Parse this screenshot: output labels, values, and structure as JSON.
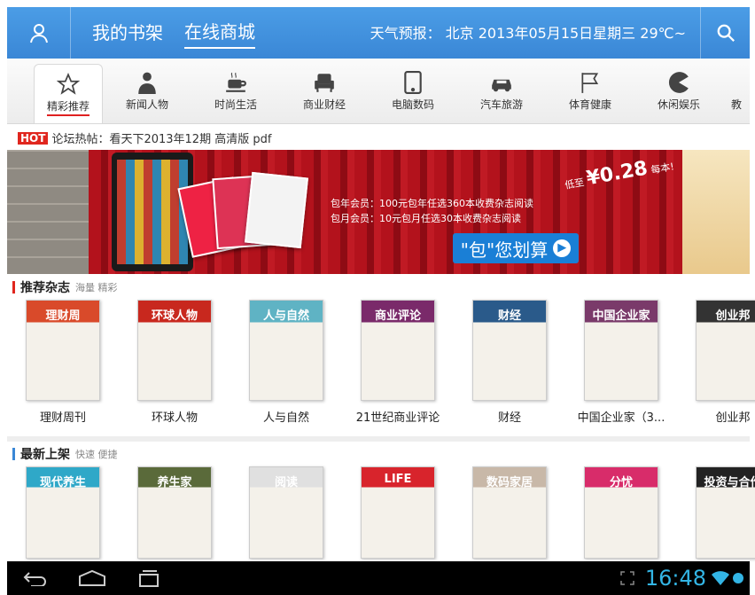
{
  "header": {
    "nav": [
      "我的书架",
      "在线商城"
    ],
    "active_nav": 1,
    "weather": "天气预报： 北京 2013年05月15日星期三 29℃~"
  },
  "categories": [
    {
      "label": "精彩推荐",
      "icon": "star-icon"
    },
    {
      "label": "新闻人物",
      "icon": "person-icon"
    },
    {
      "label": "时尚生活",
      "icon": "coffee-icon"
    },
    {
      "label": "商业财经",
      "icon": "armchair-icon"
    },
    {
      "label": "电脑数码",
      "icon": "tablet-icon"
    },
    {
      "label": "汽车旅游",
      "icon": "car-icon"
    },
    {
      "label": "体育健康",
      "icon": "flag-icon"
    },
    {
      "label": "休闲娱乐",
      "icon": "pacman-icon"
    },
    {
      "label": "教",
      "icon": "book-icon"
    }
  ],
  "hot": {
    "badge": "HOT",
    "text": "论坛热帖：看天下2013年12期 高清版 pdf"
  },
  "banner": {
    "line1": "包年会员：100元包年任选360本收费杂志阅读",
    "line2": "包月会员：10元包月任选30本收费杂志阅读",
    "button": "\"包\"您划算",
    "price_prefix": "低至",
    "price": "¥0.28",
    "price_suffix": "每本!"
  },
  "recommended": {
    "title": "推荐杂志",
    "subtitle": "海量 精彩",
    "items": [
      {
        "name": "理财周刊",
        "cover": "理财周",
        "color": "#d94a2a"
      },
      {
        "name": "环球人物",
        "cover": "环球人物",
        "color": "#c8281e"
      },
      {
        "name": "人与自然",
        "cover": "人与自然",
        "color": "#5fb3c4"
      },
      {
        "name": "21世纪商业评论",
        "cover": "商业评论",
        "color": "#7a2a6a"
      },
      {
        "name": "财经",
        "cover": "财经",
        "color": "#2a5a8a"
      },
      {
        "name": "中国企业家（3...",
        "cover": "中国企业家",
        "color": "#7a3a6a"
      },
      {
        "name": "创业邦",
        "cover": "创业邦",
        "color": "#333"
      }
    ]
  },
  "newest": {
    "title": "最新上架",
    "subtitle": "快速 便捷",
    "items": [
      {
        "cover": "现代养生",
        "color": "#2fa8c8"
      },
      {
        "cover": "养生家",
        "color": "#5a6a3a"
      },
      {
        "cover": "阅读",
        "color": "#e0e0e0"
      },
      {
        "cover": "LIFE",
        "color": "#d8242c"
      },
      {
        "cover": "数码家居",
        "color": "#c8b8a8"
      },
      {
        "cover": "分忧",
        "color": "#d82c6a"
      },
      {
        "cover": "投资与合作",
        "color": "#222"
      }
    ]
  },
  "statusbar": {
    "time": "16:48"
  }
}
